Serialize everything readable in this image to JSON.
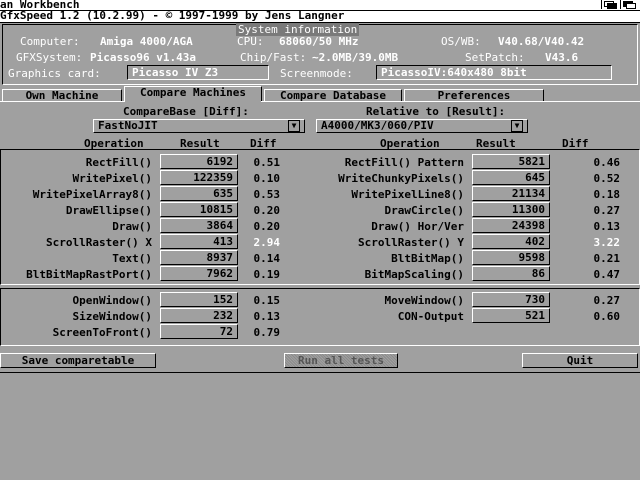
{
  "screen": {
    "title": "an Workbench"
  },
  "window": {
    "title": "GfxSpeed 1.2 (10.2.99) - © 1997-1999 by Jens Langner"
  },
  "sysinfo": {
    "header": "System information",
    "computer_label": "Computer:",
    "computer_value": "Amiga 4000/AGA",
    "cpu_label": "CPU:",
    "cpu_value": "68060/50 MHz",
    "os_label": "OS/WB:",
    "os_value": "V40.68/V40.42",
    "gfx_label": "GFXSystem:",
    "gfx_value": "Picasso96 v1.43a",
    "chip_label": "Chip/Fast:",
    "chip_value": "~2.0MB/39.0MB",
    "setpatch_label": "SetPatch:",
    "setpatch_value": "V43.6",
    "card_label": "Graphics card:",
    "card_value": "Picasso IV Z3",
    "screenmode_label": "Screenmode:",
    "screenmode_value": "PicassoIV:640x480  8bit"
  },
  "tabs": [
    "Own Machine",
    "Compare Machines",
    "Compare Database",
    "Preferences"
  ],
  "compare": {
    "base_label": "CompareBase [Diff]:",
    "base_value": "FastNoJIT",
    "relative_label": "Relative to [Result]:",
    "relative_value": "A4000/MK3/060/PIV"
  },
  "columns": {
    "left": {
      "op": "Operation",
      "result": "Result",
      "diff": "Diff"
    },
    "right": {
      "op": "Operation",
      "result": "Result",
      "diff": "Diff"
    }
  },
  "tests_left": [
    {
      "op": "RectFill()",
      "result": "6192",
      "diff": "0.51"
    },
    {
      "op": "WritePixel()",
      "result": "122359",
      "diff": "0.10"
    },
    {
      "op": "WritePixelArray8()",
      "result": "635",
      "diff": "0.53"
    },
    {
      "op": "DrawEllipse()",
      "result": "10815",
      "diff": "0.20"
    },
    {
      "op": "Draw()",
      "result": "3864",
      "diff": "0.20"
    },
    {
      "op": "ScrollRaster() X",
      "result": "413",
      "diff": "2.94"
    },
    {
      "op": "Text()",
      "result": "8937",
      "diff": "0.14"
    },
    {
      "op": "BltBitMapRastPort()",
      "result": "7962",
      "diff": "0.19"
    }
  ],
  "tests_right": [
    {
      "op": "RectFill() Pattern",
      "result": "5821",
      "diff": "0.46"
    },
    {
      "op": "WriteChunkyPixels()",
      "result": "645",
      "diff": "0.52"
    },
    {
      "op": "WritePixelLine8()",
      "result": "21134",
      "diff": "0.18"
    },
    {
      "op": "DrawCircle()",
      "result": "11300",
      "diff": "0.27"
    },
    {
      "op": "Draw() Hor/Ver",
      "result": "24398",
      "diff": "0.13"
    },
    {
      "op": "ScrollRaster() Y",
      "result": "402",
      "diff": "3.22"
    },
    {
      "op": "BltBitMap()",
      "result": "9598",
      "diff": "0.21"
    },
    {
      "op": "BitMapScaling()",
      "result": "86",
      "diff": "0.47"
    }
  ],
  "tests2_left": [
    {
      "op": "OpenWindow()",
      "result": "152",
      "diff": "0.15"
    },
    {
      "op": "SizeWindow()",
      "result": "232",
      "diff": "0.13"
    },
    {
      "op": "ScreenToFront()",
      "result": "72",
      "diff": "0.79"
    }
  ],
  "tests2_right": [
    {
      "op": "MoveWindow()",
      "result": "730",
      "diff": "0.27"
    },
    {
      "op": "CON-Output",
      "result": "521",
      "diff": "0.60"
    }
  ],
  "buttons": {
    "save": "Save comparetable",
    "run": "Run all tests",
    "quit": "Quit"
  },
  "colors": {
    "background": "#a0a0a0",
    "highlight": "#ffffff",
    "shadow": "#000000"
  }
}
